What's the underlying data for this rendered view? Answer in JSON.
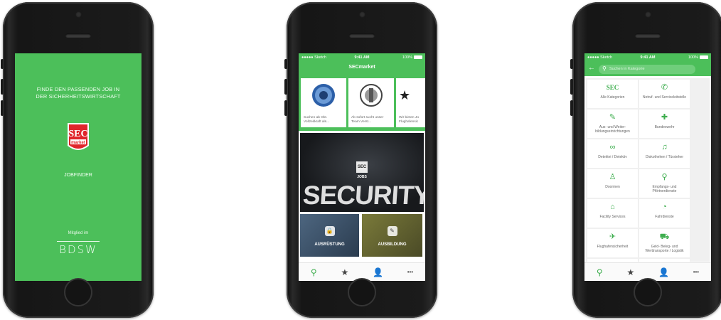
{
  "colors": {
    "brand_green": "#4cbf5a",
    "accent_red": "#e0252b",
    "tab_active": "#3fae4f"
  },
  "status_bar": {
    "carrier": "●●●●● Sketch",
    "wifi_icon": "wifi-icon",
    "time": "9:41 AM",
    "battery": "100%"
  },
  "splash": {
    "headline_line1": "FINDE DEN PASSENDEN JOB IN",
    "headline_line2": "DER SICHERHEITSWIRTSCHAFT",
    "logo_top": "SEC",
    "logo_bottom": "market",
    "jobfinder": "JOBFINDER",
    "member_of": "Mitglied im",
    "partner_logo": "BDSW"
  },
  "home": {
    "title": "SECmarket",
    "cards": [
      {
        "caption": "Suchen ab Okt. Vollzeitkraft als..."
      },
      {
        "caption": "Ab sofort sucht unser Team Verst..."
      },
      {
        "caption": "Wir bieten Jo Flughafensic"
      }
    ],
    "hero_word": "SECURITY",
    "hero_badge": "SEC",
    "hero_label": "JOBS",
    "tiles": [
      {
        "label": "AUSRÜSTUNG",
        "icon": "lock-icon"
      },
      {
        "label": "AUSBILDUNG",
        "icon": "pencil-icon"
      }
    ],
    "tabbar": [
      {
        "icon": "search-icon",
        "glyph": "⚲"
      },
      {
        "icon": "star-icon",
        "glyph": "★"
      },
      {
        "icon": "user-icon",
        "glyph": "👤"
      },
      {
        "icon": "more-icon",
        "glyph": "•••"
      }
    ]
  },
  "categories": {
    "search_placeholder": "Suchen in Kategorie",
    "items": [
      {
        "label": "Alle Kategorien",
        "icon": "sec-icon"
      },
      {
        "label": "Notruf- und Serviceleitstelle",
        "icon": "phone-icon"
      },
      {
        "label": "Aus- und Weiter-bildungseinrichtungen",
        "icon": "pencil-icon"
      },
      {
        "label": "Bundeswehr",
        "icon": "medical-cross-icon"
      },
      {
        "label": "Detektei / Detektiv",
        "icon": "binoculars-icon"
      },
      {
        "label": "Diskotheken / Türsteher",
        "icon": "music-note-icon"
      },
      {
        "label": "Doormen",
        "icon": "doorman-icon"
      },
      {
        "label": "Empfangs- und Pförtnerdienste",
        "icon": "reception-icon"
      },
      {
        "label": "Facility Services",
        "icon": "house-icon"
      },
      {
        "label": "Fahrdienste",
        "icon": "speedometer-icon"
      },
      {
        "label": "Flughafensicherheit",
        "icon": "airplane-icon"
      },
      {
        "label": "Geld- Beleg- und Werttransporte / Logistik",
        "icon": "truck-icon"
      }
    ]
  }
}
